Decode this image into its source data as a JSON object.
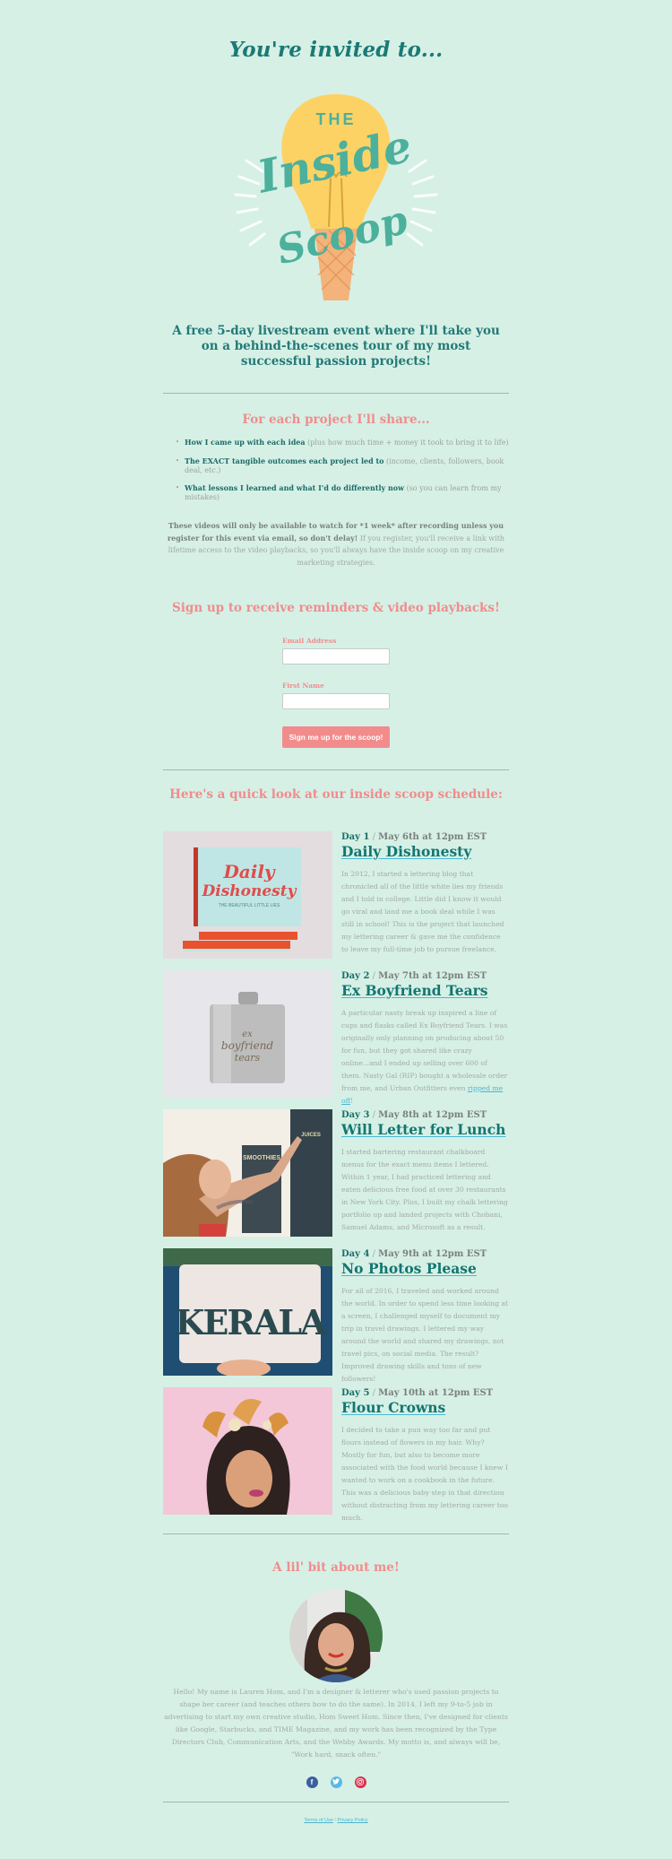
{
  "header": {
    "invite": "You're invited to...",
    "logo": {
      "top_word": "THE",
      "main_word": "Inside",
      "bottom_word": "Scoop",
      "alt": "The Inside Scoop lightbulb ice-cream cone logo"
    },
    "subtitle": "A free 5-day livestream event where I'll take you on a behind-the-scenes tour of my most successful passion projects!"
  },
  "share": {
    "heading": "For each project I'll share...",
    "items": [
      {
        "bold": "How I came up with each idea",
        "rest": " (plus how much time + money it took to bring it to life)"
      },
      {
        "bold": "The EXACT tangible outcomes each project led to",
        "rest": " (income, clients, followers, book deal, etc.)"
      },
      {
        "bold": "What lessons I learned and what I'd do differently now",
        "rest": " (so you can learn from my mistakes)"
      }
    ],
    "notice_bold": "These videos will only be available to watch for *1 week* after recording unless you register for this event via email, so don't delay!",
    "notice_rest": " If you register, you'll receive a link with lifetime access to the video playbacks, so you'll always have the inside scoop on my creative marketing strategies."
  },
  "signup": {
    "heading": "Sign up to receive reminders & video playbacks!",
    "email_label": "Email Address",
    "email_value": "",
    "first_name_label": "First Name",
    "first_name_value": "",
    "submit_label": "Sign me up for the scoop!"
  },
  "schedule": {
    "heading": "Here's a quick look at our inside scoop schedule:",
    "days": [
      {
        "day": "Day 1",
        "separator": " / ",
        "date": "May 6th at 12pm EST",
        "title": "Daily Dishonesty",
        "image_alt": "Daily Dishonesty book stack",
        "description": "In 2012, I started a lettering blog that chronicled all of the little white lies my friends and I told in college. Little did I know it would go viral and land me a book deal while I was still in school! This is the project that launched my lettering career & gave me the confidence to leave my full-time job to pursue freelance."
      },
      {
        "day": "Day 2",
        "separator": " / ",
        "date": "May 7th at 12pm EST",
        "title": "Ex Boyfriend Tears",
        "image_alt": "Ex Boyfriend Tears flask",
        "description": "A particular nasty break up inspired a line of cups and flasks called Ex Boyfriend Tears. I was originally only planning on producing about 50 for fun, but they got shared like crazy online...and I ended up selling over 600 of them. Nasty Gal (RIP) bought a wholesale order from me, and Urban Outfitters even ",
        "link_text": "ripped me off",
        "after_link": "!"
      },
      {
        "day": "Day 3",
        "separator": " / ",
        "date": "May 8th at 12pm EST",
        "title": "Will Letter for Lunch",
        "image_alt": "Lettering a chalkboard menu",
        "description": "I started bartering restaurant chalkboard menus for the exact menu items I lettered. Within 1 year, I had practiced lettering and eaten delicious free food at over 30 restaurants in New York City. Plus, I built my chalk lettering portfolio up and landed projects with Chobani, Samuel Adams, and Microsoft as a result."
      },
      {
        "day": "Day 4",
        "separator": " / ",
        "date": "May 9th at 12pm EST",
        "title": "No Photos Please",
        "image_alt": "Kerala lettering sketchbook",
        "image_word": "KERALA",
        "description": "For all of 2016, I traveled and worked around the world. In order to spend less time looking at a screen, I challenged myself to document my trip in travel drawings. I lettered my way around the world and shared my drawings, not travel pics, on social media. The result? Improved drawing skills and tons of new followers!"
      },
      {
        "day": "Day 5",
        "separator": " / ",
        "date": "May 10th at 12pm EST",
        "title": "Flour Crowns",
        "image_alt": "Croissant flour crown",
        "description": "I decided to take a pun way too far and put flours instead of flowers in my hair. Why? Mostly for fun, but also to become more associated with the food world because I knew I wanted to work on a cookbook in the future. This was a delicious baby step in that direction without distracting from my lettering career too much."
      }
    ]
  },
  "about": {
    "heading": "A lil' bit about me!",
    "bio": "Hello! My name is Lauren Hom, and I'm a designer & letterer who's used passion projects to shape her career (and teaches others how to do the same). In 2014, I left my 9-to-5 job in advertising to start my own creative studio, Hom Sweet Hom. Since then, I've designed for clients like Google, Starbucks, and TIME Magazine, and my work has been recognized by the Type Directors Club, Communication Arts, and the Webby Awards. My motto is, and always will be, \"Work hard, snack often.\""
  },
  "social": [
    {
      "name": "facebook",
      "icon": "facebook-icon",
      "glyph": "f",
      "color": "#3b5f9e"
    },
    {
      "name": "twitter",
      "icon": "twitter-icon",
      "glyph": "t",
      "color": "#58b8e8"
    },
    {
      "name": "instagram",
      "icon": "instagram-icon",
      "glyph": "◎",
      "color": "#d8304e"
    }
  ],
  "footer": {
    "terms": "Terms of Use",
    "separator": " / ",
    "privacy": "Privacy Policy"
  },
  "colors": {
    "background": "#d6f0e6",
    "teal": "#1a7a74",
    "pink": "#f28c8c",
    "link": "#4ab6d0"
  }
}
